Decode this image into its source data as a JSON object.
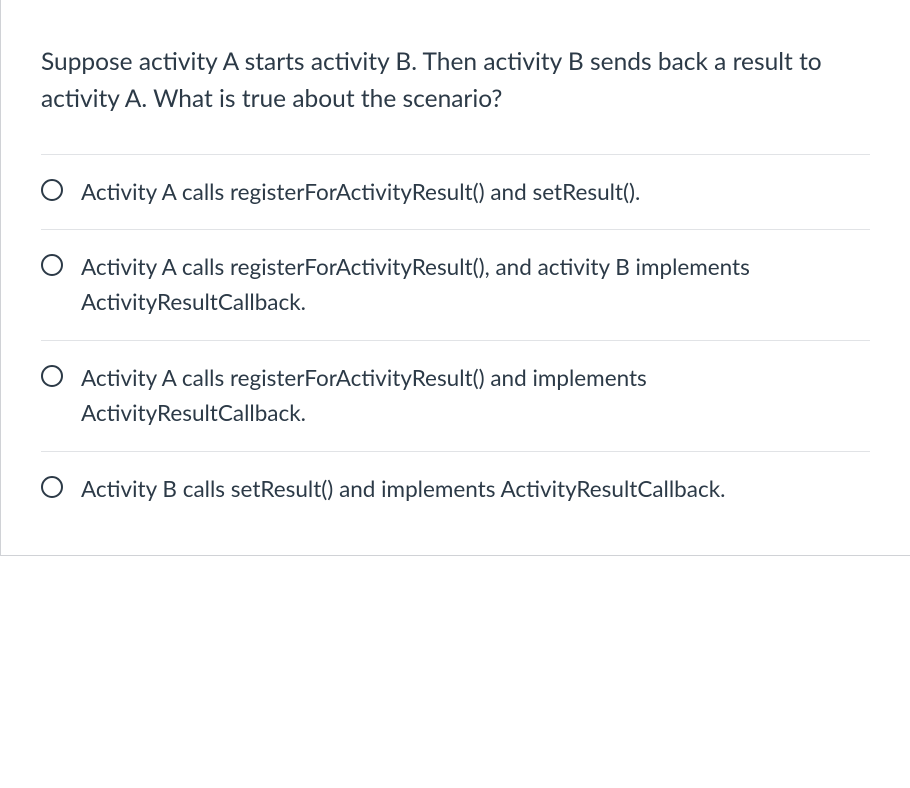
{
  "question": "Suppose activity A starts activity B. Then activity B sends back a result to activity A. What is true about the scenario?",
  "options": [
    {
      "text": "Activity A calls registerForActivityResult() and setResult()."
    },
    {
      "text": "Activity A calls registerForActivityResult(), and activity B implements ActivityResultCallback."
    },
    {
      "text": "Activity A calls registerForActivityResult() and implements ActivityResultCallback."
    },
    {
      "text": "Activity B calls setResult() and implements ActivityResultCallback."
    }
  ]
}
